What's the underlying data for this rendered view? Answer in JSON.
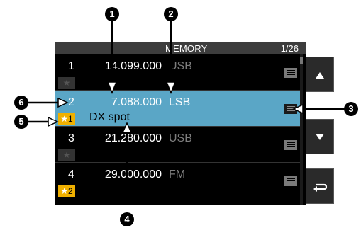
{
  "header": {
    "title": "MEMORY",
    "page": "1/26"
  },
  "rows": [
    {
      "num": "1",
      "freq": "14.099.000",
      "mode": "USB",
      "star": "★",
      "group": "",
      "name": ""
    },
    {
      "num": "2",
      "freq": "7.088.000",
      "mode": "LSB",
      "star": "★",
      "group": "1",
      "name": "DX spot"
    },
    {
      "num": "3",
      "freq": "21.280.000",
      "mode": "USB",
      "star": "★",
      "group": "",
      "name": ""
    },
    {
      "num": "4",
      "freq": "29.000.000",
      "mode": "FM",
      "star": "★",
      "group": "2",
      "name": ""
    }
  ],
  "nav": {
    "up": "up-arrow-icon",
    "down": "down-arrow-icon",
    "back": "return-icon"
  },
  "callouts": [
    "1",
    "2",
    "3",
    "4",
    "5",
    "6"
  ],
  "colors": {
    "selected_row": "#5aa6c6",
    "group_star": "#f0b000",
    "screen_bg": "#000000"
  }
}
